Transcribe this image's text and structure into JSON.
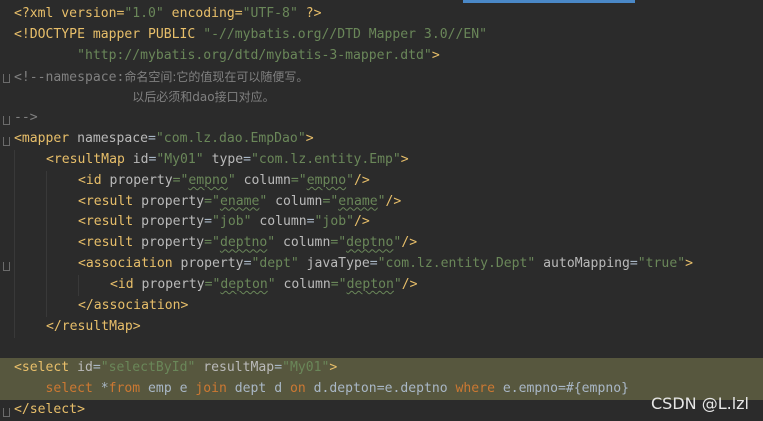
{
  "editor": {
    "watermark": "CSDN @L.lzl",
    "colors": {
      "background": "#2b2b2b",
      "tag": "#e8bf6a",
      "attribute": "#bababa",
      "string": "#6a8759",
      "comment": "#808080",
      "keyword": "#cc7832",
      "text": "#a9b7c6",
      "selection": "#57573e"
    }
  },
  "code": {
    "l1": {
      "a": "<?xml version=",
      "b": "\"1.0\"",
      "c": " encoding=",
      "d": "\"UTF-8\"",
      "e": " ?>"
    },
    "l2": {
      "a": "<!DOCTYPE mapper PUBLIC ",
      "b": "\"-//mybatis.org//DTD Mapper 3.0//EN\""
    },
    "l3": {
      "a": "        ",
      "b": "\"http://mybatis.org/dtd/mybatis-3-mapper.dtd\"",
      "c": ">"
    },
    "l4": {
      "a": "<!--namespace:",
      "b": "命名空间:它的值现在可以随便写。"
    },
    "l5": {
      "a": "               ",
      "b": "以后必须和dao接口对应。"
    },
    "l6": {
      "a": "-->"
    },
    "l7": {
      "a": "<mapper ",
      "b": "namespace",
      "c": "=",
      "d": "\"com.lz.dao.EmpDao\"",
      "e": ">"
    },
    "l8": {
      "a": "<resultMap ",
      "b": "id",
      "c": "=",
      "d": "\"My01\"",
      "e": " type",
      "f": "=",
      "g": "\"com.lz.entity.Emp\"",
      "h": ">"
    },
    "l9": {
      "a": "<id ",
      "b": "property",
      "c": "=\"",
      "d": "empno",
      "e": "\"",
      "f": " column",
      "g": "=\"",
      "h": "empno",
      "i": "\"",
      "j": "/>"
    },
    "l10": {
      "a": "<result ",
      "b": "property",
      "c": "=\"",
      "d": "ename",
      "e": "\"",
      "f": " column",
      "g": "=\"",
      "h": "ename",
      "i": "\"",
      "j": "/>"
    },
    "l11": {
      "a": "<result ",
      "b": "property",
      "c": "=",
      "d": "\"job\"",
      "e": " column",
      "f": "=",
      "g": "\"job\"",
      "h": "/>"
    },
    "l12": {
      "a": "<result ",
      "b": "property",
      "c": "=\"",
      "d": "deptno",
      "e": "\"",
      "f": " column",
      "g": "=\"",
      "h": "deptno",
      "i": "\"",
      "j": "/>"
    },
    "l13": {
      "a": "<association ",
      "b": "property",
      "c": "=",
      "d": "\"dept\"",
      "e": " javaType",
      "f": "=",
      "g": "\"com.lz.entity.Dept\"",
      "h": " autoMapping",
      "i": "=",
      "j": "\"true\"",
      "k": ">"
    },
    "l14": {
      "a": "<id ",
      "b": "property",
      "c": "=\"",
      "d": "depton",
      "e": "\"",
      "f": " column",
      "g": "=\"",
      "h": "depton",
      "i": "\"",
      "j": "/>"
    },
    "l15": {
      "a": "</association>"
    },
    "l16": {
      "a": "</resultMap>"
    },
    "l17": {
      "a": ""
    },
    "l18": {
      "a": "<select ",
      "b": "id",
      "c": "=",
      "d": "\"selectById\"",
      "e": " resultMap",
      "f": "=",
      "g": "\"My01\"",
      "h": ">"
    },
    "l19": {
      "a": "    ",
      "b": "select ",
      "c": "*",
      "d": "from ",
      "e": "emp e ",
      "f": "join ",
      "g": "dept d ",
      "h": "on ",
      "i": "d.depton=e.deptno ",
      "j": "where ",
      "k": "e.empno=#{empno}"
    },
    "l20": {
      "a": "</select>"
    }
  }
}
